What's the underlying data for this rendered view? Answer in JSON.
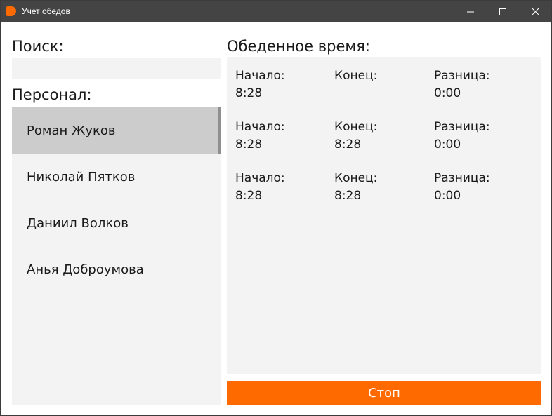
{
  "window": {
    "title": "Учет обедов",
    "accent_color": "#ff6a00",
    "controls": {
      "minimize_icon": "minimize-icon",
      "maximize_icon": "maximize-icon",
      "close_icon": "close-icon"
    }
  },
  "search": {
    "label": "Поиск:",
    "value": "",
    "placeholder": ""
  },
  "staff": {
    "label": "Персонал:",
    "selected_index": 0,
    "items": [
      {
        "name": "Роман Жуков"
      },
      {
        "name": "Николай Пятков"
      },
      {
        "name": "Даниил Волков"
      },
      {
        "name": "Анья Доброумова"
      }
    ]
  },
  "lunch": {
    "label": "Обеденное время:",
    "records": [
      {
        "start_label": "Начало:",
        "start": "8:28",
        "end_label": "Конец:",
        "end": "",
        "diff_label": "Разница:",
        "diff": "0:00"
      },
      {
        "start_label": "Начало:",
        "start": "8:28",
        "end_label": "Конец:",
        "end": "8:28",
        "diff_label": "Разница:",
        "diff": "0:00"
      },
      {
        "start_label": "Начало:",
        "start": "8:28",
        "end_label": "Конец:",
        "end": "8:28",
        "diff_label": "Разница:",
        "diff": "0:00"
      }
    ]
  },
  "stop_button": {
    "label": "Стоп",
    "color": "#ff6a00"
  }
}
